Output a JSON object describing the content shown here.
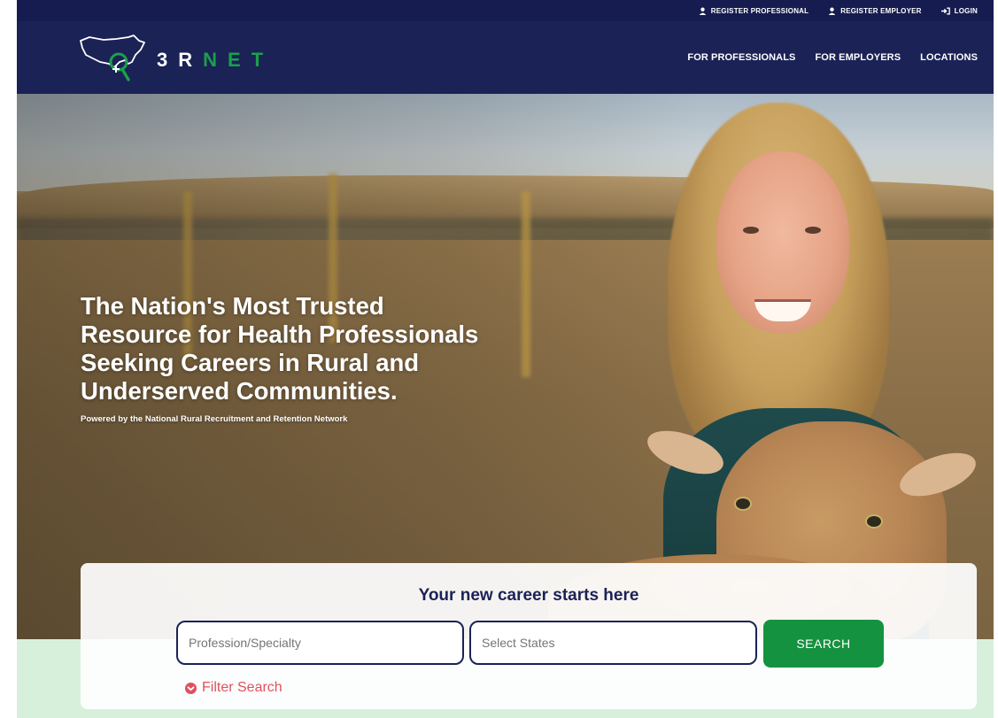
{
  "utility_nav": {
    "register_professional": "REGISTER PROFESSIONAL",
    "register_employer": "REGISTER EMPLOYER",
    "login": "LOGIN",
    "icons": [
      "user-icon",
      "user-icon",
      "sign-in-icon"
    ]
  },
  "header": {
    "logo": {
      "letters": [
        "3",
        "R",
        "N",
        "E",
        "T"
      ]
    },
    "nav": [
      "FOR PROFESSIONALS",
      "FOR EMPLOYERS",
      "LOCATIONS"
    ]
  },
  "hero": {
    "title_lines": [
      "The Nation's Most Trusted",
      "Resource for Health Professionals",
      "Seeking Careers in Rural and",
      "Underserved Communities."
    ],
    "subtitle": "Powered by the National Rural Recruitment and Retention Network"
  },
  "search": {
    "heading": "Your new career starts here",
    "profession_placeholder": "Profession/Specialty",
    "states_placeholder": "Select States",
    "button": "SEARCH",
    "filter_label": "Filter Search"
  },
  "colors": {
    "navy": "#1b2256",
    "topbar": "#161c4f",
    "brand_green": "#15923f",
    "band_green": "#d7f0dc",
    "filter_red": "#e0505e"
  }
}
